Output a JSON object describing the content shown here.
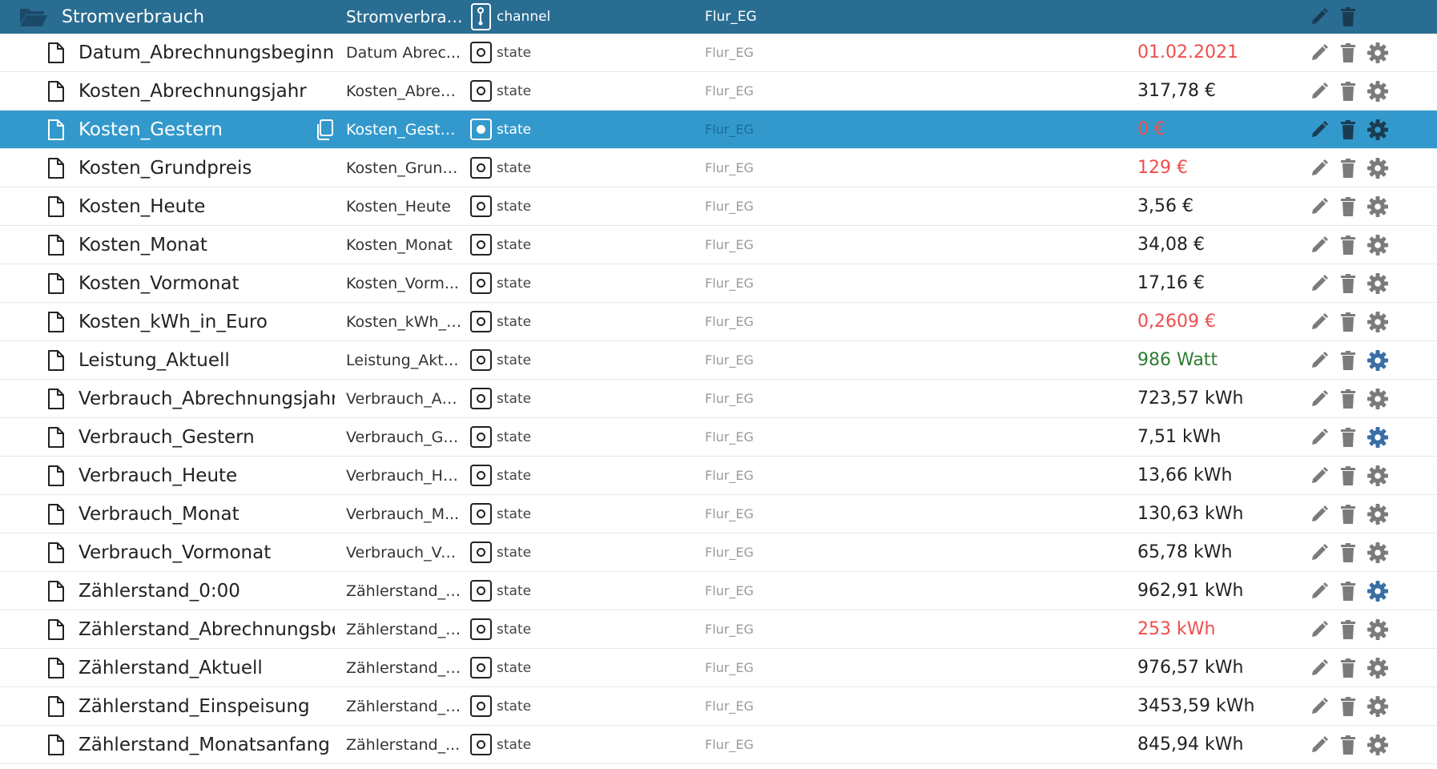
{
  "header": {
    "id": "Stromverbrauch",
    "name": "Stromverbrauch",
    "type": "channel",
    "room": "Flur_EG",
    "icon": "folder-open-icon"
  },
  "colors": {
    "header_bg": "#2a6d92",
    "selected_bg": "#3399cc",
    "value_red": "#ee4d4d",
    "value_green": "#2e7d32",
    "gear_active": "#3a6ea5"
  },
  "rows": [
    {
      "id": "Datum_Abrechnungsbeginn",
      "name": "Datum Abrec...",
      "type": "state",
      "room": "Flur_EG",
      "value": "01.02.2021",
      "value_color": "red",
      "gear_active": false
    },
    {
      "id": "Kosten_Abrechnungsjahr",
      "name": "Kosten_Abrec...",
      "type": "state",
      "room": "Flur_EG",
      "value": "317,78 €",
      "value_color": "default",
      "gear_active": false
    },
    {
      "id": "Kosten_Gestern",
      "name": "Kosten_Gestern",
      "type": "state",
      "room": "Flur_EG",
      "value": "0 €",
      "value_color": "red",
      "gear_active": false,
      "selected": true
    },
    {
      "id": "Kosten_Grundpreis",
      "name": "Kosten_Grund...",
      "type": "state",
      "room": "Flur_EG",
      "value": "129 €",
      "value_color": "red",
      "gear_active": false
    },
    {
      "id": "Kosten_Heute",
      "name": "Kosten_Heute",
      "type": "state",
      "room": "Flur_EG",
      "value": "3,56 €",
      "value_color": "default",
      "gear_active": false
    },
    {
      "id": "Kosten_Monat",
      "name": "Kosten_Monat",
      "type": "state",
      "room": "Flur_EG",
      "value": "34,08 €",
      "value_color": "default",
      "gear_active": false
    },
    {
      "id": "Kosten_Vormonat",
      "name": "Kosten_Vorm...",
      "type": "state",
      "room": "Flur_EG",
      "value": "17,16 €",
      "value_color": "default",
      "gear_active": false
    },
    {
      "id": "Kosten_kWh_in_Euro",
      "name": "Kosten_kWh_i...",
      "type": "state",
      "room": "Flur_EG",
      "value": "0,2609 €",
      "value_color": "red",
      "gear_active": false
    },
    {
      "id": "Leistung_Aktuell",
      "name": "Leistung_Aktu...",
      "type": "state",
      "room": "Flur_EG",
      "value": "986 Watt",
      "value_color": "green",
      "gear_active": true
    },
    {
      "id": "Verbrauch_Abrechnungsjahr",
      "name": "Verbrauch_Ab...",
      "type": "state",
      "room": "Flur_EG",
      "value": "723,57 kWh",
      "value_color": "default",
      "gear_active": false
    },
    {
      "id": "Verbrauch_Gestern",
      "name": "Verbrauch_Ge...",
      "type": "state",
      "room": "Flur_EG",
      "value": "7,51 kWh",
      "value_color": "default",
      "gear_active": true
    },
    {
      "id": "Verbrauch_Heute",
      "name": "Verbrauch_He...",
      "type": "state",
      "room": "Flur_EG",
      "value": "13,66 kWh",
      "value_color": "default",
      "gear_active": false
    },
    {
      "id": "Verbrauch_Monat",
      "name": "Verbrauch_M...",
      "type": "state",
      "room": "Flur_EG",
      "value": "130,63 kWh",
      "value_color": "default",
      "gear_active": false
    },
    {
      "id": "Verbrauch_Vormonat",
      "name": "Verbrauch_Vo...",
      "type": "state",
      "room": "Flur_EG",
      "value": "65,78 kWh",
      "value_color": "default",
      "gear_active": false
    },
    {
      "id": "Zählerstand_0:00",
      "name": "Zählerstand_0...",
      "type": "state",
      "room": "Flur_EG",
      "value": "962,91 kWh",
      "value_color": "default",
      "gear_active": true
    },
    {
      "id": "Zählerstand_Abrechnungsbe...",
      "name": "Zählerstand_A...",
      "type": "state",
      "room": "Flur_EG",
      "value": "253 kWh",
      "value_color": "red",
      "gear_active": false
    },
    {
      "id": "Zählerstand_Aktuell",
      "name": "Zählerstand_A...",
      "type": "state",
      "room": "Flur_EG",
      "value": "976,57 kWh",
      "value_color": "default",
      "gear_active": false
    },
    {
      "id": "Zählerstand_Einspeisung",
      "name": "Zählerstand_E...",
      "type": "state",
      "room": "Flur_EG",
      "value": "3453,59 kWh",
      "value_color": "default",
      "gear_active": false
    },
    {
      "id": "Zählerstand_Monatsanfang",
      "name": "Zählerstand_...",
      "type": "state",
      "room": "Flur_EG",
      "value": "845,94 kWh",
      "value_color": "default",
      "gear_active": false
    }
  ]
}
